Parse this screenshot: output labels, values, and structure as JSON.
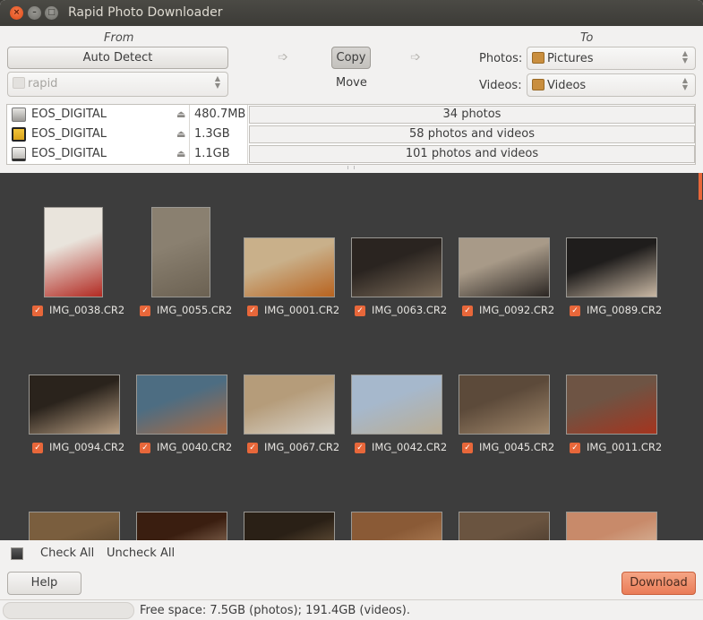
{
  "window": {
    "title": "Rapid Photo Downloader",
    "controls": [
      "close",
      "minimize",
      "maximize"
    ]
  },
  "from": {
    "heading": "From",
    "auto_detect_label": "Auto Detect",
    "source_folder": "rapid"
  },
  "mode": {
    "copy_label": "Copy",
    "move_label": "Move",
    "selected": "Copy"
  },
  "to": {
    "heading": "To",
    "photos_label": "Photos:",
    "photos_folder": "Pictures",
    "videos_label": "Videos:",
    "videos_folder": "Videos"
  },
  "devices": [
    {
      "name": "EOS_DIGITAL",
      "size": "480.7MB",
      "status": "34 photos",
      "icon": "hard-drive-icon"
    },
    {
      "name": "EOS_DIGITAL",
      "size": "1.3GB",
      "status": "58 photos and videos",
      "icon": "memory-card-icon"
    },
    {
      "name": "EOS_DIGITAL",
      "size": "1.1GB",
      "status": "101 photos and videos",
      "icon": "drive-icon"
    }
  ],
  "thumbnails": [
    {
      "file": "IMG_0038.CR2",
      "checked": true,
      "orientation": "portrait",
      "colors": [
        "#e9e4dc",
        "#b22a22"
      ]
    },
    {
      "file": "IMG_0055.CR2",
      "checked": true,
      "orientation": "portrait",
      "colors": [
        "#8a8070",
        "#6b6152"
      ]
    },
    {
      "file": "IMG_0001.CR2",
      "checked": true,
      "orientation": "landscape",
      "colors": [
        "#c9b08a",
        "#b8631f"
      ]
    },
    {
      "file": "IMG_0063.CR2",
      "checked": true,
      "orientation": "landscape",
      "colors": [
        "#2a2420",
        "#7a6a58"
      ]
    },
    {
      "file": "IMG_0092.CR2",
      "checked": true,
      "orientation": "landscape",
      "colors": [
        "#a89a88",
        "#2b2623"
      ]
    },
    {
      "file": "IMG_0089.CR2",
      "checked": true,
      "orientation": "landscape",
      "colors": [
        "#1f1d1c",
        "#c9b8a4"
      ]
    },
    {
      "file": "IMG_0094.CR2",
      "checked": true,
      "orientation": "landscape",
      "colors": [
        "#2a231c",
        "#b89e82"
      ]
    },
    {
      "file": "IMG_0040.CR2",
      "checked": true,
      "orientation": "landscape",
      "colors": [
        "#4d6d82",
        "#a86a45"
      ]
    },
    {
      "file": "IMG_0067.CR2",
      "checked": true,
      "orientation": "landscape",
      "colors": [
        "#b59c7a",
        "#d9d4ca"
      ]
    },
    {
      "file": "IMG_0042.CR2",
      "checked": true,
      "orientation": "landscape",
      "colors": [
        "#a6b8cc",
        "#b9ad95"
      ]
    },
    {
      "file": "IMG_0045.CR2",
      "checked": true,
      "orientation": "landscape",
      "colors": [
        "#5c4a3a",
        "#a0876b"
      ]
    },
    {
      "file": "IMG_0011.CR2",
      "checked": true,
      "orientation": "landscape",
      "colors": [
        "#6e5444",
        "#a5341e"
      ]
    },
    {
      "file": "",
      "checked": true,
      "orientation": "landscape",
      "colors": [
        "#7a5e3e",
        "#4a3a28"
      ]
    },
    {
      "file": "",
      "checked": true,
      "orientation": "landscape",
      "colors": [
        "#3a1e10",
        "#b4967c"
      ]
    },
    {
      "file": "",
      "checked": true,
      "orientation": "landscape",
      "colors": [
        "#2a2016",
        "#8a7050"
      ]
    },
    {
      "file": "",
      "checked": true,
      "orientation": "landscape",
      "colors": [
        "#8a5a36",
        "#c4946a"
      ]
    },
    {
      "file": "",
      "checked": true,
      "orientation": "landscape",
      "colors": [
        "#6a5440",
        "#3a2e24"
      ]
    },
    {
      "file": "",
      "checked": true,
      "orientation": "landscape",
      "colors": [
        "#c88a6a",
        "#e0d0b8"
      ]
    }
  ],
  "selection": {
    "check_all_label": "Check All",
    "uncheck_all_label": "Uncheck All"
  },
  "actions": {
    "help_label": "Help",
    "download_label": "Download"
  },
  "status": {
    "free_space": "Free space: 7.5GB (photos); 191.4GB (videos)."
  },
  "colors": {
    "accent": "#e8673a",
    "grid_background": "#3d3d3d",
    "window_background": "#f2f1f0"
  }
}
